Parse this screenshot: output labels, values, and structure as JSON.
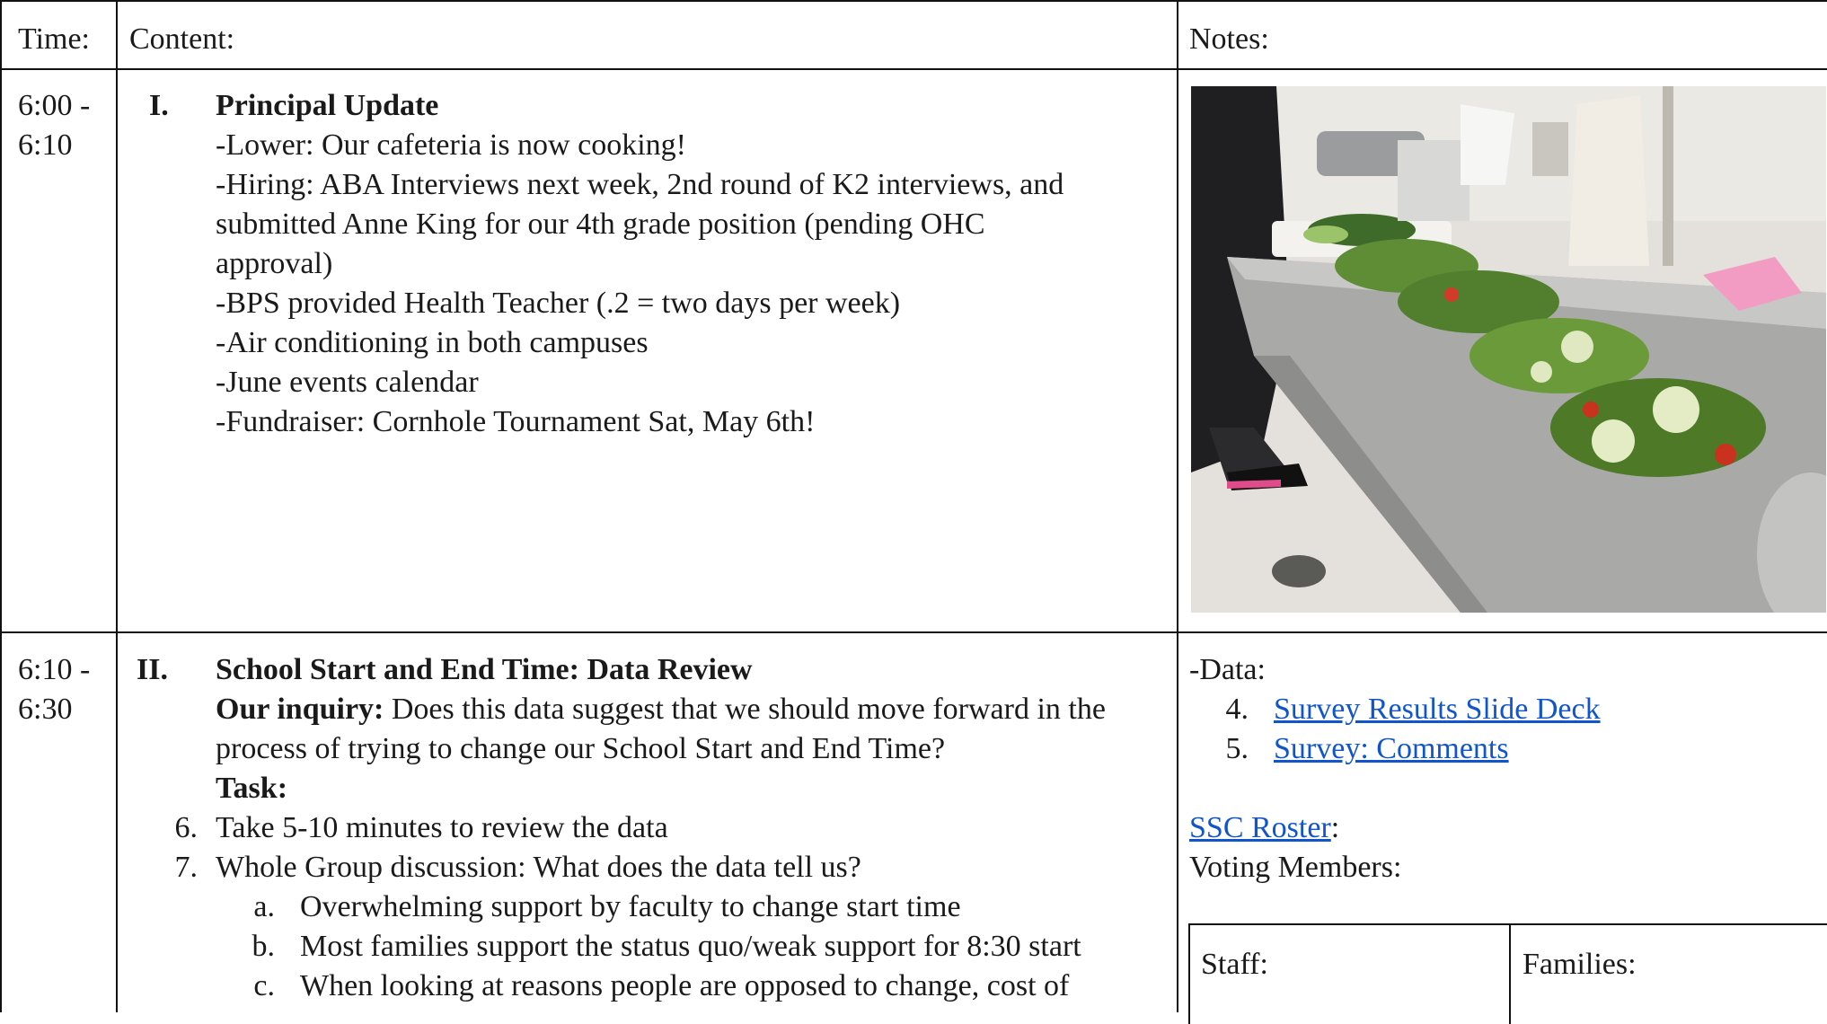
{
  "table": {
    "header": {
      "time": "Time:",
      "content": "Content:",
      "notes": "Notes:"
    },
    "rows": [
      {
        "time_line1": "6:00 -",
        "time_line2": "6:10",
        "numeral": "I.",
        "title": "Principal Update",
        "lines": [
          "-Lower: Our cafeteria is now cooking!",
          "-Hiring: ABA Interviews next week, 2nd round of K2 interviews, and",
          "submitted Anne King for our 4th grade position (pending OHC",
          "approval)",
          "-BPS provided Health Teacher (.2  = two days per week)",
          "-Air conditioning in both campuses",
          "-June events calendar",
          "-Fundraiser: Cornhole Tournament Sat, May 6th!"
        ]
      },
      {
        "time_line1": "6:10 -",
        "time_line2": "6:30",
        "numeral": "II.",
        "title": "School Start and End Time: Data Review",
        "inquiry_label": "Our inquiry:",
        "inquiry_line1": " Does this data suggest that we should move forward in the",
        "inquiry_line2": "process of trying to change our School Start and End Time?",
        "task_label": "Task:",
        "steps": [
          {
            "num": "6.",
            "text": "Take 5-10 minutes to review the data"
          },
          {
            "num": "7.",
            "text": "Whole Group discussion: What does the data tell us?"
          }
        ],
        "substeps": [
          {
            "num": "a.",
            "text": "Overwhelming support by faculty to change start time"
          },
          {
            "num": "b.",
            "text": "Most families support the status quo/weak support for 8:30 start"
          },
          {
            "num": "c.",
            "text": "When looking at reasons people are opposed to change, cost of"
          }
        ],
        "notes": {
          "data_label": "-Data:",
          "links": [
            {
              "num": "4.",
              "text": "Survey Results Slide Deck"
            },
            {
              "num": "5.",
              "text": "Survey: Comments"
            }
          ],
          "roster_link": "SSC Roster",
          "roster_colon": ":",
          "voting_label": "Voting Members:",
          "staff_label": "Staff:",
          "families_label": "Families:"
        }
      }
    ]
  },
  "colors": {
    "link": "#1155cc",
    "border": "#111111"
  }
}
